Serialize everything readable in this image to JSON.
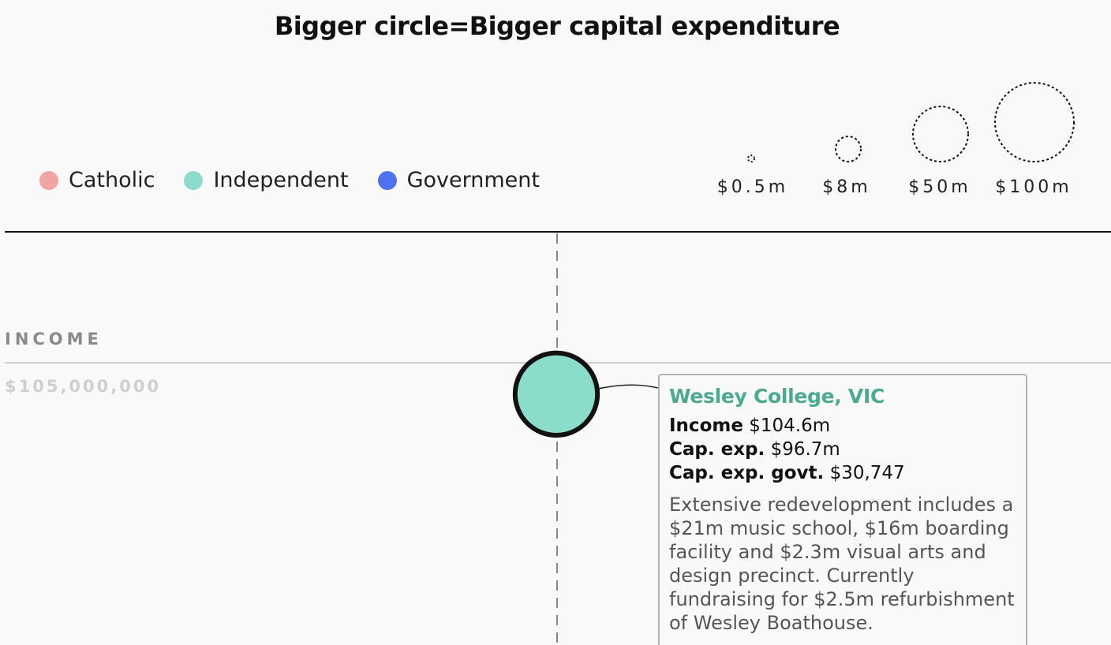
{
  "header": {
    "title": "Bigger circle=Bigger capital expenditure"
  },
  "legend": {
    "items": [
      {
        "label": "Catholic",
        "color": "#f0a4a4"
      },
      {
        "label": "Independent",
        "color": "#8adccb"
      },
      {
        "label": "Government",
        "color": "#4f72f0"
      }
    ]
  },
  "size_legend": {
    "items": [
      {
        "label": "$0.5m",
        "value_m": 0.5
      },
      {
        "label": "$8m",
        "value_m": 8
      },
      {
        "label": "$50m",
        "value_m": 50
      },
      {
        "label": "$100m",
        "value_m": 100
      }
    ]
  },
  "chart_data": {
    "type": "scatter",
    "title": "Bigger circle=Bigger capital expenditure",
    "ylabel": "INCOME",
    "y_ticks": [
      "$105,000,000"
    ],
    "size_encoding": "capital expenditure",
    "color_encoding": "school sector",
    "points": [
      {
        "name": "Wesley College, VIC",
        "sector": "Independent",
        "income": 104600000,
        "capex": 96700000,
        "capex_govt": 30747,
        "highlighted": true
      }
    ]
  },
  "tooltip": {
    "name": "Wesley College, VIC",
    "name_color": "#4aab8f",
    "income_label": "Income",
    "income_value": "$104.6m",
    "capex_label": "Cap. exp.",
    "capex_value": "$96.7m",
    "capex_govt_label": "Cap. exp. govt.",
    "capex_govt_value": "$30,747",
    "description": "Extensive redevelopment includes a $21m music school, $16m boarding facility and $2.3m visual arts and design precinct. Currently fundraising for $2.5m refurbishment of Wesley Boathouse."
  }
}
